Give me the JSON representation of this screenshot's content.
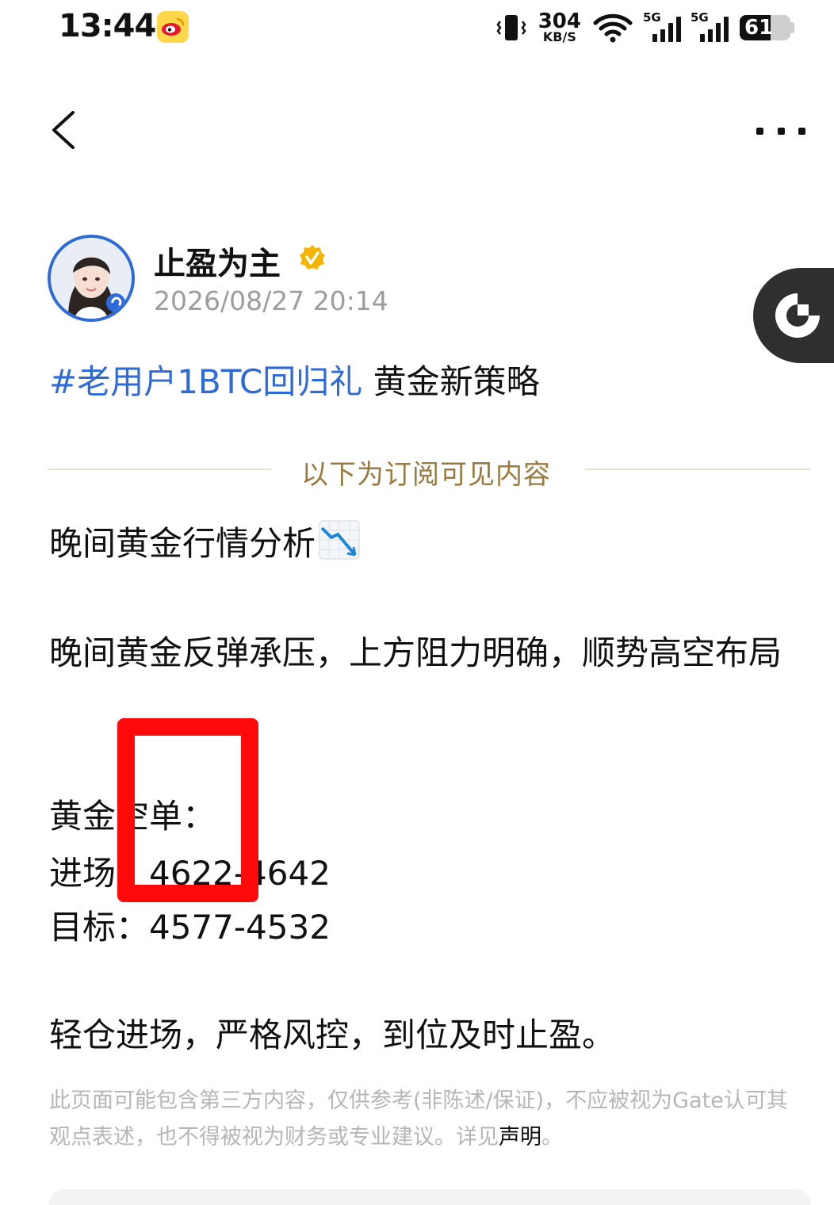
{
  "status_bar": {
    "time": "13:44",
    "app_icon": "weibo-icon",
    "net_speed_value": "304",
    "net_speed_unit": "KB/S",
    "signal1_label": "5G",
    "signal2_label": "5G",
    "battery_level": "61"
  },
  "header": {
    "back_icon": "chevron-left-icon",
    "more_icon": "more-horizontal-icon"
  },
  "author": {
    "name": "止盈为主",
    "date": "2026/08/27 20:14",
    "verified_color": "#f5b400"
  },
  "post": {
    "hashtag": "#老用户1BTC回归礼",
    "title": "黄金新策略",
    "divider_label": "以下为订阅可见内容",
    "heading": "晚间黄金行情分析",
    "analysis": "晚间黄金反弹承压，上方阻力明确，顺势高空布局",
    "order_label": "黄金空单：",
    "entry": "进场：4622-4642",
    "target": "目标：4577-4532",
    "advice": "轻仓进场，严格风控，到位及时止盈。"
  },
  "disclaimer": {
    "text": "此页面可能包含第三方内容，仅供参考(非陈述/保证)，不应被视为Gate认可其观点表述，也不得被视为财务或专业建议。详见",
    "link": "声明",
    "end": "。"
  },
  "colors": {
    "accent_blue": "#2f6bd8",
    "gold": "#9a7a3e",
    "annotation_red": "#ff0a0a"
  }
}
